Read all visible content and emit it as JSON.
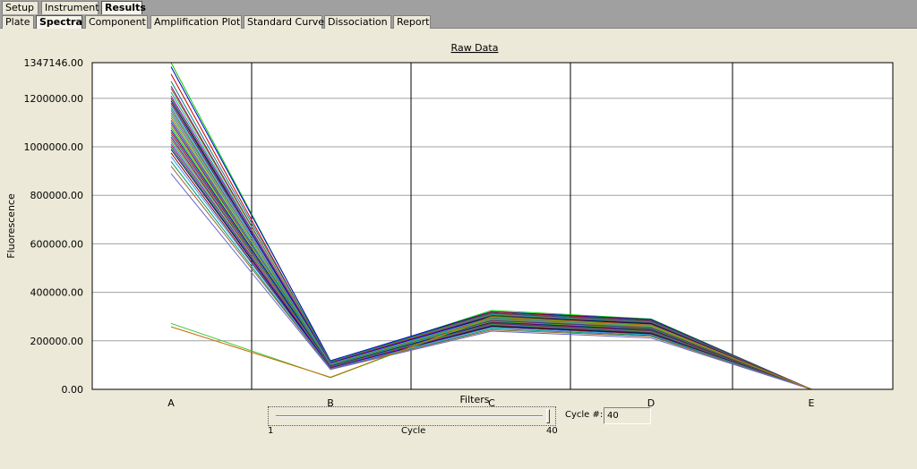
{
  "main_tabs": [
    {
      "label": "Setup",
      "active": false
    },
    {
      "label": "Instrument",
      "active": false
    },
    {
      "label": "Results",
      "active": true
    }
  ],
  "sub_tabs": [
    {
      "label": "Plate",
      "active": false
    },
    {
      "label": "Spectra",
      "active": true
    },
    {
      "label": "Component",
      "active": false
    },
    {
      "label": "Amplification Plot",
      "active": false
    },
    {
      "label": "Standard Curve",
      "active": false
    },
    {
      "label": "Dissociation",
      "active": false
    },
    {
      "label": "Report",
      "active": false
    }
  ],
  "filters_label": "Filters",
  "slider": {
    "min_label": "1",
    "max_label": "40",
    "caption": "Cycle",
    "value": 40
  },
  "cycle_field": {
    "label": "Cycle #:",
    "value": "40"
  },
  "chart_data": {
    "type": "line",
    "title": "Raw Data",
    "xlabel": "",
    "ylabel": "Fluorescence",
    "categories": [
      "A",
      "B",
      "C",
      "D",
      "E"
    ],
    "ylim": [
      0,
      1347146.0
    ],
    "yticks": [
      "0.00",
      "200000.00",
      "400000.00",
      "600000.00",
      "800000.00",
      "1000000.00",
      "1200000.00",
      "1347146.00"
    ],
    "ytick_values": [
      0,
      200000,
      400000,
      600000,
      800000,
      1000000,
      1200000,
      1347146
    ],
    "grid": true,
    "vertical_dividers": true,
    "series_colors": [
      "#00cc00",
      "#0000cc",
      "#cc0000",
      "#008080",
      "#800080",
      "#808000",
      "#00aaaa",
      "#aa00aa",
      "#006600",
      "#000088",
      "#880000",
      "#3399ff",
      "#009966",
      "#996633",
      "#6666cc",
      "#33cc33",
      "#cc6600",
      "#0066cc",
      "#660099",
      "#999900"
    ],
    "series": [
      {
        "values": [
          1347146,
          112000,
          325000,
          290000,
          0
        ]
      },
      {
        "values": [
          1330000,
          118000,
          320000,
          288000,
          0
        ]
      },
      {
        "values": [
          1300000,
          110000,
          318000,
          285000,
          0
        ]
      },
      {
        "values": [
          1270000,
          115000,
          315000,
          283000,
          0
        ]
      },
      {
        "values": [
          1250000,
          108000,
          312000,
          280000,
          0
        ]
      },
      {
        "values": [
          1240000,
          112000,
          310000,
          278000,
          0
        ]
      },
      {
        "values": [
          1225000,
          105000,
          308000,
          276000,
          0
        ]
      },
      {
        "values": [
          1210000,
          110000,
          305000,
          274000,
          0
        ]
      },
      {
        "values": [
          1200000,
          102000,
          303000,
          272000,
          0
        ]
      },
      {
        "values": [
          1190000,
          108000,
          300000,
          270000,
          0
        ]
      },
      {
        "values": [
          1180000,
          100000,
          298000,
          268000,
          0
        ]
      },
      {
        "values": [
          1170000,
          106000,
          296000,
          266000,
          0
        ]
      },
      {
        "values": [
          1160000,
          98000,
          294000,
          264000,
          0
        ]
      },
      {
        "values": [
          1150000,
          104000,
          292000,
          262000,
          0
        ]
      },
      {
        "values": [
          1140000,
          96000,
          290000,
          260000,
          0
        ]
      },
      {
        "values": [
          1130000,
          102000,
          288000,
          258000,
          0
        ]
      },
      {
        "values": [
          1120000,
          95000,
          286000,
          256000,
          0
        ]
      },
      {
        "values": [
          1110000,
          100000,
          284000,
          254000,
          0
        ]
      },
      {
        "values": [
          1100000,
          93000,
          282000,
          252000,
          0
        ]
      },
      {
        "values": [
          1090000,
          98000,
          280000,
          250000,
          0
        ]
      },
      {
        "values": [
          1080000,
          92000,
          278000,
          248000,
          0
        ]
      },
      {
        "values": [
          1070000,
          96000,
          276000,
          246000,
          0
        ]
      },
      {
        "values": [
          1060000,
          90000,
          274000,
          244000,
          0
        ]
      },
      {
        "values": [
          1050000,
          94000,
          272000,
          242000,
          0
        ]
      },
      {
        "values": [
          1040000,
          88000,
          270000,
          240000,
          0
        ]
      },
      {
        "values": [
          1030000,
          92000,
          268000,
          238000,
          0
        ]
      },
      {
        "values": [
          1020000,
          86000,
          266000,
          236000,
          0
        ]
      },
      {
        "values": [
          1010000,
          90000,
          264000,
          234000,
          0
        ]
      },
      {
        "values": [
          1000000,
          85000,
          262000,
          232000,
          0
        ]
      },
      {
        "values": [
          990000,
          88000,
          260000,
          230000,
          0
        ]
      },
      {
        "values": [
          975000,
          84000,
          258000,
          228000,
          0
        ]
      },
      {
        "values": [
          960000,
          86000,
          255000,
          225000,
          0
        ]
      },
      {
        "values": [
          940000,
          83000,
          250000,
          222000,
          0
        ]
      },
      {
        "values": [
          920000,
          85000,
          245000,
          218000,
          0
        ]
      },
      {
        "values": [
          890000,
          82000,
          240000,
          212000,
          0
        ]
      },
      {
        "values": [
          272000,
          48000,
          298000,
          262000,
          0
        ]
      },
      {
        "values": [
          258000,
          50000,
          300000,
          265000,
          0
        ]
      }
    ]
  }
}
